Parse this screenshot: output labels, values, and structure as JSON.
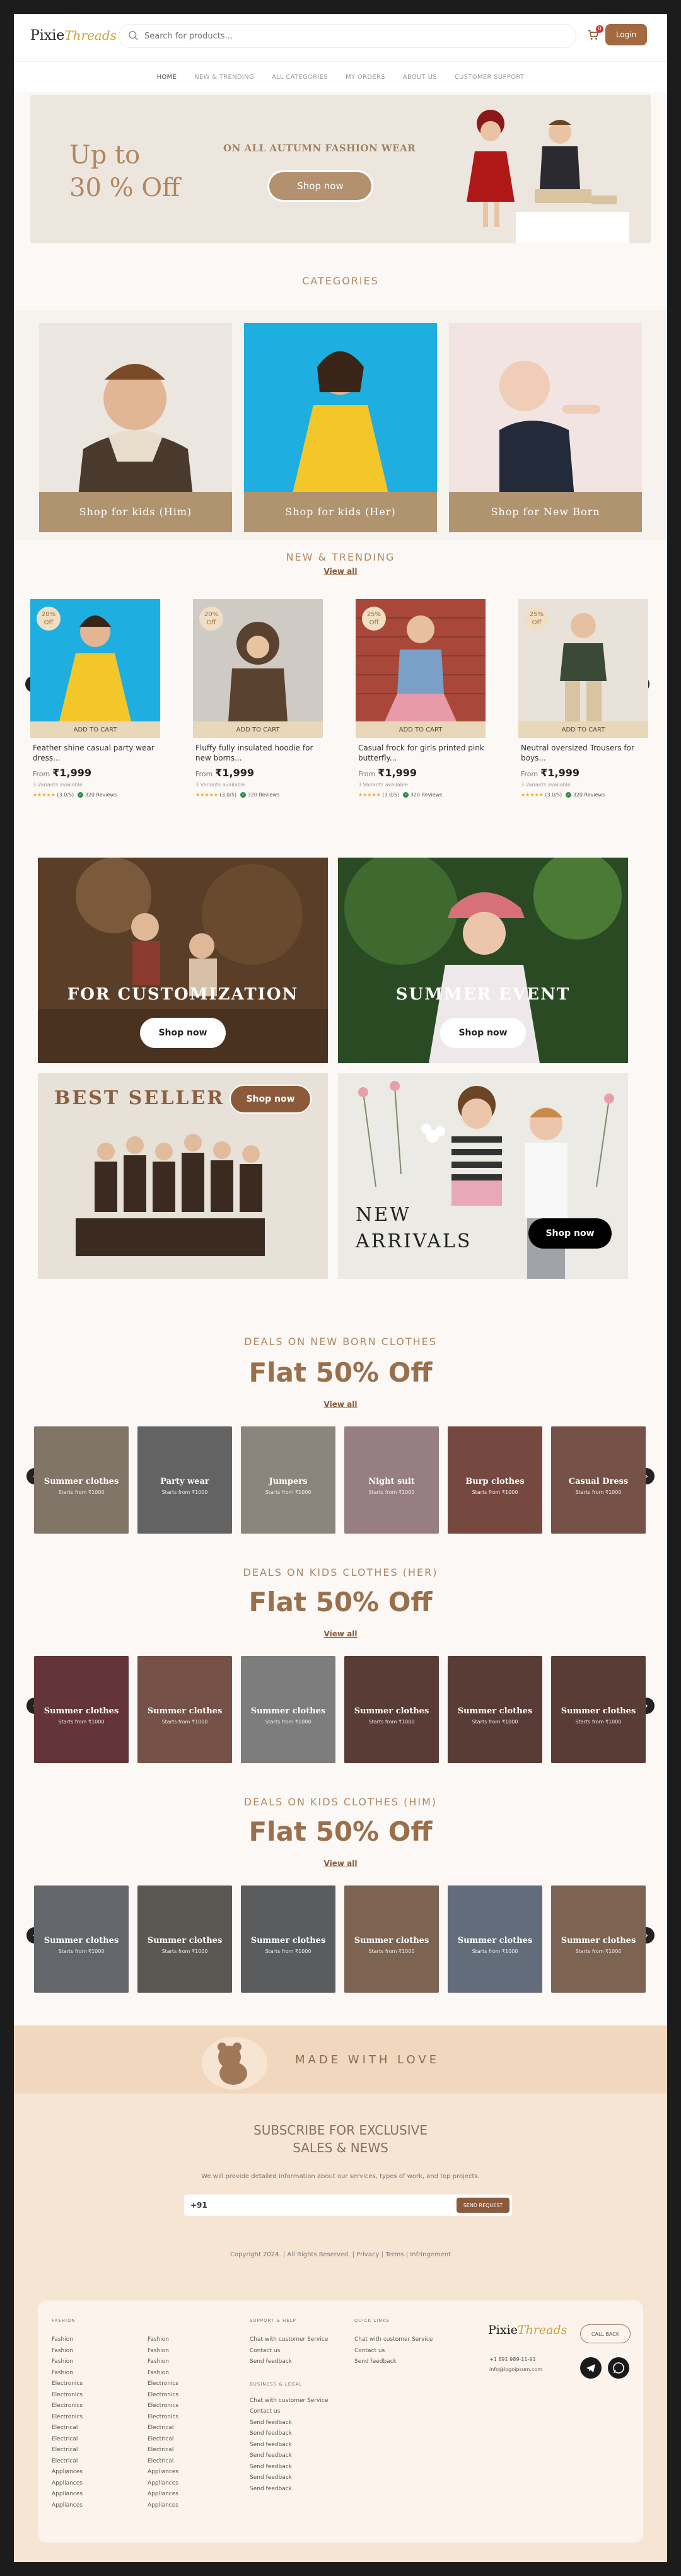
{
  "header": {
    "logo_part1": "Pixie",
    "logo_part2": "Threads",
    "search_placeholder": "Search for products...",
    "cart_count": "0",
    "login_label": "Login"
  },
  "nav": [
    "HOME",
    "NEW & TRENDING",
    "ALL CATEGORIES",
    "MY ORDERS",
    "ABOUT US",
    "CUSTOMER SUPPORT"
  ],
  "hero": {
    "line1": "Up to",
    "line2": "30 % Off",
    "subtitle": "ON ALL AUTUMN FASHION WEAR",
    "button": "Shop now"
  },
  "categories": {
    "title": "CATEGORIES",
    "items": [
      "Shop for kids (Him)",
      "Shop for kids (Her)",
      "Shop for New Born"
    ]
  },
  "trending": {
    "title": "NEW & TRENDING",
    "view_all": "View all",
    "products": [
      {
        "discount": "20%",
        "off": "Off",
        "add": "ADD TO CART",
        "name": "Feather shine casual party wear dress...",
        "from": "From",
        "price": "₹1,999",
        "variants": "3 Variants available",
        "stars": "★★★★★",
        "rating": "(3.0/5)",
        "reviews": "320 Reviews"
      },
      {
        "discount": "20%",
        "off": "Off",
        "add": "ADD TO CART",
        "name": "Fluffy fully insulated hoodie for new borns...",
        "from": "From",
        "price": "₹1,999",
        "variants": "3 Variants available",
        "stars": "★★★★★",
        "rating": "(3.0/5)",
        "reviews": "320 Reviews"
      },
      {
        "discount": "25%",
        "off": "Off",
        "add": "ADD TO CART",
        "name": "Casual frock for girls printed pink butterfly...",
        "from": "From",
        "price": "₹1,999",
        "variants": "3 Variants available",
        "stars": "★★★★★",
        "rating": "(3.0/5)",
        "reviews": "320 Reviews"
      },
      {
        "discount": "25%",
        "off": "Off",
        "add": "ADD TO CART",
        "name": "Neutral oversized Trousers for boys...",
        "from": "From",
        "price": "₹1,999",
        "variants": "3 Variants available",
        "stars": "★★★★★",
        "rating": "(3.0/5)",
        "reviews": "320 Reviews"
      }
    ]
  },
  "banners": {
    "customization": {
      "title": "FOR CUSTOMIZATION",
      "button": "Shop now"
    },
    "summer": {
      "title": "SUMMER EVENT",
      "button": "Shop now"
    },
    "bestseller": {
      "title": "BEST SELLER",
      "button": "Shop now"
    },
    "arrivals": {
      "line1": "NEW",
      "line2": "ARRIVALS",
      "button": "Shop now"
    }
  },
  "deals": [
    {
      "title": "DEALS ON NEW BORN CLOTHES",
      "offer": "Flat 50% Off",
      "view_all": "View all",
      "items": [
        {
          "name": "Summer clothes",
          "price": "Starts from ₹1000"
        },
        {
          "name": "Party wear",
          "price": "Starts from ₹1000"
        },
        {
          "name": "Jumpers",
          "price": "Starts from ₹1000"
        },
        {
          "name": "Night suit",
          "price": "Starts from ₹1000"
        },
        {
          "name": "Burp clothes",
          "price": "Starts from ₹1000"
        },
        {
          "name": "Casual Dress",
          "price": "Starts from ₹1000"
        }
      ]
    },
    {
      "title": "DEALS ON KIDS CLOTHES (HER)",
      "offer": "Flat 50% Off",
      "view_all": "View all",
      "items": [
        {
          "name": "Summer clothes",
          "price": "Starts from ₹1000"
        },
        {
          "name": "Summer clothes",
          "price": "Starts from ₹1000"
        },
        {
          "name": "Summer clothes",
          "price": "Starts from ₹1000"
        },
        {
          "name": "Summer clothes",
          "price": "Starts from ₹1000"
        },
        {
          "name": "Summer clothes",
          "price": "Starts from ₹1000"
        },
        {
          "name": "Summer clothes",
          "price": "Starts from ₹1000"
        }
      ]
    },
    {
      "title": "DEALS ON KIDS CLOTHES (HIM)",
      "offer": "Flat 50% Off",
      "view_all": "View all",
      "items": [
        {
          "name": "Summer clothes",
          "price": "Starts from ₹1000"
        },
        {
          "name": "Summer clothes",
          "price": "Starts from ₹1000"
        },
        {
          "name": "Summer clothes",
          "price": "Starts from ₹1000"
        },
        {
          "name": "Summer clothes",
          "price": "Starts from ₹1000"
        },
        {
          "name": "Summer clothes",
          "price": "Starts from ₹1000"
        },
        {
          "name": "Summer clothes",
          "price": "Starts from ₹1000"
        }
      ]
    }
  ],
  "made_with_love": "MADE WITH LOVE",
  "subscribe": {
    "line1": "SUBSCRIBE FOR EXCLUSIVE",
    "line2": "SALES & NEWS",
    "desc": "We will provide detailed information about our services, types of work, and top projects.",
    "phone_value": "+91",
    "button": "SEND REQUEST",
    "copyright": "Copyright 2024.  | All Rights Reserved. | Privacy | Terms | Infringement"
  },
  "footer": {
    "fashion_heading": "FASHION",
    "col1": [
      "Fashion",
      "Fashion",
      "Fashion",
      "Fashion",
      "Electronics",
      "Electronics",
      "Electronics",
      "Electronics",
      "Electrical",
      "Electrical",
      "Electrical",
      "Electrical",
      "Appliances",
      "Appliances",
      "Appliances",
      "Appliances"
    ],
    "col2": [
      "Fashion",
      "Fashion",
      "Fashion",
      "Fashion",
      "Electronics",
      "Electronics",
      "Electronics",
      "Electronics",
      "Electrical",
      "Electrical",
      "Electrical",
      "Electrical",
      "Appliances",
      "Appliances",
      "Appliances",
      "Appliances"
    ],
    "support_heading": "SUPPORT & HELP",
    "support": [
      "Chat with customer Service",
      "Contact us",
      "Send feedback"
    ],
    "business_heading": "BUSINESS & LEGAL",
    "business": [
      "Chat with customer Service",
      "Contact us",
      "Send feedback",
      "Send feedback",
      "Send feedback",
      "Send feedback",
      "Send feedback",
      "Send feedback",
      "Send feedback"
    ],
    "quick_heading": "QUICK LINKS",
    "quick": [
      "Chat with customer Service",
      "Contact us",
      "Send feedback"
    ],
    "callback": "CALL BACK",
    "phone": "+1 891 989-11-91",
    "email": "info@logoipsum.com"
  },
  "colors": {
    "accent": "#a36a41",
    "gold": "#b08760",
    "tan": "#b09470"
  }
}
